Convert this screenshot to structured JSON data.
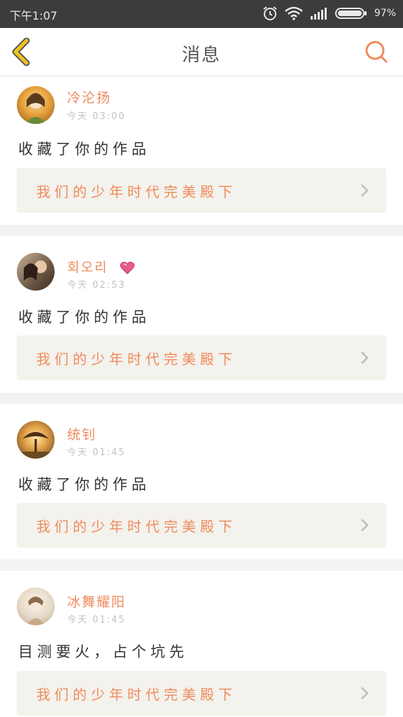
{
  "status_bar": {
    "time": "下午1:07",
    "battery_percent": "97%",
    "icons": [
      "alarm-icon",
      "wifi-icon",
      "signal-icon",
      "battery-icon"
    ]
  },
  "header": {
    "title": "消息",
    "back_icon": "back-chevron-icon",
    "search_icon": "search-icon"
  },
  "colors": {
    "accent": "#f08a5d",
    "back_chevron": "#f0c419",
    "work_card_bg": "#f3f2ec"
  },
  "messages": [
    {
      "user": "冷沦扬",
      "time_day": "今天",
      "time_clock": "03:00",
      "text": "收藏了你的作品",
      "work_title": "我们的少年时代完美殿下",
      "badge": ""
    },
    {
      "user": "회오리",
      "time_day": "今天",
      "time_clock": "02:53",
      "text": "收藏了你的作品",
      "work_title": "我们的少年时代完美殿下",
      "badge": "heart-icon"
    },
    {
      "user": "统钊",
      "time_day": "今天",
      "time_clock": "01:45",
      "text": "收藏了你的作品",
      "work_title": "我们的少年时代完美殿下",
      "badge": ""
    },
    {
      "user": "冰舞耀阳",
      "time_day": "今天",
      "time_clock": "01:45",
      "text": "目测要火，占个坑先",
      "work_title": "我们的少年时代完美殿下",
      "badge": ""
    }
  ]
}
